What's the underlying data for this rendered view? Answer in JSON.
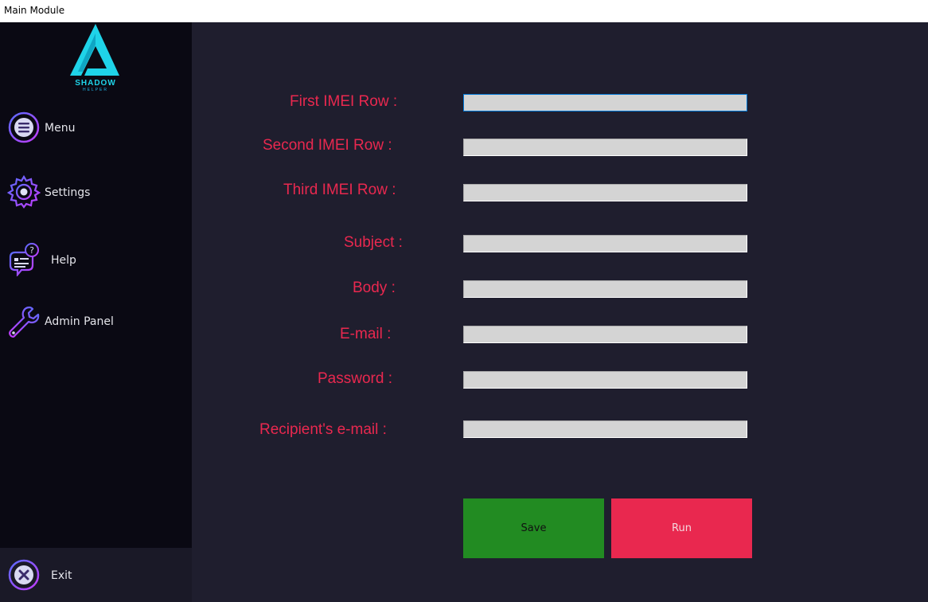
{
  "window": {
    "title": "Main Module"
  },
  "logo": {
    "brand": "SHADOW",
    "sub": "HELPER"
  },
  "sidebar": {
    "items": [
      {
        "label": "Menu",
        "icon": "menu-icon"
      },
      {
        "label": "Settings",
        "icon": "gear-icon"
      },
      {
        "label": "Help",
        "icon": "help-chat-icon"
      },
      {
        "label": "Admin Panel",
        "icon": "wrench-icon"
      }
    ],
    "exit": {
      "label": "Exit",
      "icon": "close-icon"
    }
  },
  "form": {
    "fields": [
      {
        "label": "First IMEI Row :",
        "value": ""
      },
      {
        "label": "Second IMEI Row :",
        "value": ""
      },
      {
        "label": "Third IMEI Row :",
        "value": ""
      },
      {
        "label": "Subject :",
        "value": ""
      },
      {
        "label": "Body :",
        "value": ""
      },
      {
        "label": "E-mail :",
        "value": ""
      },
      {
        "label": "Password :",
        "value": ""
      },
      {
        "label": "Recipient's e-mail :",
        "value": ""
      }
    ],
    "save_label": "Save",
    "run_label": "Run"
  },
  "colors": {
    "accent": "#e9284f",
    "save": "#228b22",
    "sidebar": "#0a0913",
    "content": "#1f1e2e",
    "logo": "#1fd3e8",
    "icon_ring": "#9b4dff"
  }
}
